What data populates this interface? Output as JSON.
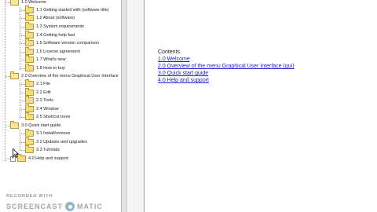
{
  "tree": {
    "items": [
      {
        "label": "1.0 Welcome"
      },
      {
        "label": "1.1 Getting started with (software title)"
      },
      {
        "label": "1.2 About (software)"
      },
      {
        "label": "1.3 System requirements"
      },
      {
        "label": "1.4 Getting help fast"
      },
      {
        "label": "1.5 Software version comparison"
      },
      {
        "label": "1.6 License agreement"
      },
      {
        "label": "1.7 What's new"
      },
      {
        "label": "1.8 How to buy"
      },
      {
        "label": "2.0 Overview of the menu Graphical User Interface"
      },
      {
        "label": "2.1 File"
      },
      {
        "label": "2.2 Edit"
      },
      {
        "label": "2.3 Tools"
      },
      {
        "label": "2.4 Window"
      },
      {
        "label": "2.5 Shortcut trees"
      },
      {
        "label": "3.0 Quick start guide"
      },
      {
        "label": "3.1 Install/remove"
      },
      {
        "label": "3.2 Updates and upgrades"
      },
      {
        "label": "3.3 Tutorials"
      },
      {
        "label": "4.0 Help and support"
      }
    ],
    "collapsed_expander": "+"
  },
  "content": {
    "contents_title": "Contents",
    "links": [
      {
        "label": "1.0 Welcome"
      },
      {
        "label": "2.0 Overview of the menu Graphical User Interface (gui)"
      },
      {
        "label": "3.0 Quick start guide"
      },
      {
        "label": "4.0 Help and support"
      }
    ]
  },
  "watermark": {
    "top": "RECORDED WITH",
    "left_word": "SCREENCAST",
    "right_word": "MATIC"
  },
  "colors": {
    "link": "#1d1dd0",
    "folder": "#f2dc7e",
    "splitter": "#e3e3e3"
  }
}
